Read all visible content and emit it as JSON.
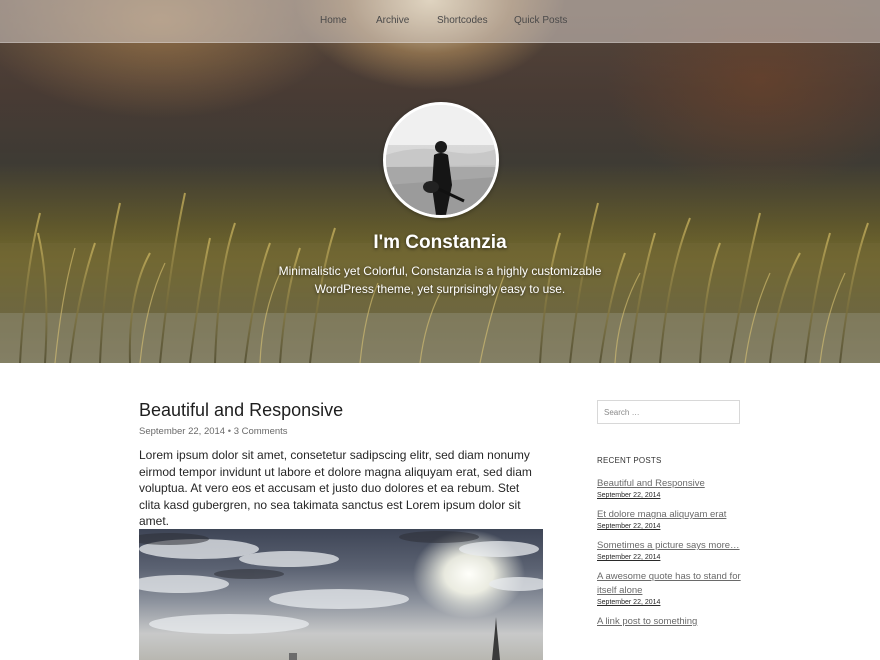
{
  "nav": {
    "items": [
      {
        "label": "Home"
      },
      {
        "label": "Archive"
      },
      {
        "label": "Shortcodes"
      },
      {
        "label": "Quick Posts"
      }
    ]
  },
  "header": {
    "title": "I'm Constanzia",
    "description": "Minimalistic yet Colorful, Constanzia is a highly customizable WordPress theme, yet surprisingly easy to use."
  },
  "post": {
    "title": "Beautiful and Responsive",
    "date": "September 22, 2014",
    "separator": "•",
    "comments": "3 Comments",
    "body": "Lorem ipsum dolor sit amet, consetetur sadipscing elitr, sed diam nonumy eirmod tempor invidunt ut labore et dolore magna aliquyam erat, sed diam voluptua. At vero eos et accusam et justo duo dolores et ea rebum. Stet clita kasd gubergren, no sea takimata sanctus est Lorem ipsum dolor sit amet."
  },
  "sidebar": {
    "search": {
      "placeholder": "Search …"
    },
    "recent_posts_title": "RECENT POSTS",
    "recent_posts": [
      {
        "title": "Beautiful and Responsive",
        "date": "September 22, 2014"
      },
      {
        "title": "Et dolore magna aliquyam erat",
        "date": "September 22, 2014"
      },
      {
        "title": "Sometimes a picture says more…",
        "date": "September 22, 2014"
      },
      {
        "title": "A awesome quote has to stand for itself alone",
        "date": "September 22, 2014"
      },
      {
        "title": "A link post to something",
        "date": ""
      }
    ]
  }
}
